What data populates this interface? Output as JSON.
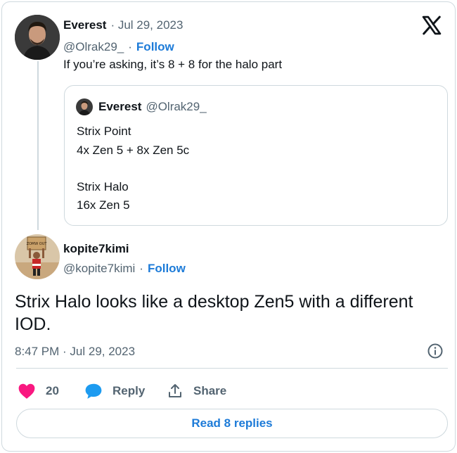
{
  "parent_tweet": {
    "author_name": "Everest",
    "separator_date": "· Jul 29, 2023",
    "handle": "@Olrak29_",
    "follow_sep": "·",
    "follow_label": "Follow",
    "text": "If you’re asking, it’s 8 + 8 for the halo part",
    "quote": {
      "author_name": "Everest",
      "handle": "@Olrak29_",
      "lines": [
        "Strix Point",
        "4x Zen 5 + 8x Zen 5c",
        "",
        "Strix Halo",
        "16x Zen 5"
      ]
    }
  },
  "main_tweet": {
    "author_name": "kopite7kimi",
    "handle": "@kopite7kimi",
    "follow_sep": "·",
    "follow_label": "Follow",
    "text_line1": "Strix Halo looks like a desktop Zen5 with a different",
    "text_line2": "IOD.",
    "timestamp": "8:47 PM · Jul 29, 2023",
    "avatar_sign": "ZOMW OUT"
  },
  "actions": {
    "like_count": "20",
    "reply_label": "Reply",
    "share_label": "Share",
    "read_replies_label": "Read 8 replies"
  },
  "colors": {
    "link": "#1d7bd8",
    "like": "#f91880",
    "reply": "#1d9bf0",
    "muted": "#536471",
    "border": "#cfd9de"
  },
  "icons": [
    "x-logo-icon",
    "info-icon",
    "heart-icon",
    "reply-bubble-icon",
    "share-icon"
  ]
}
